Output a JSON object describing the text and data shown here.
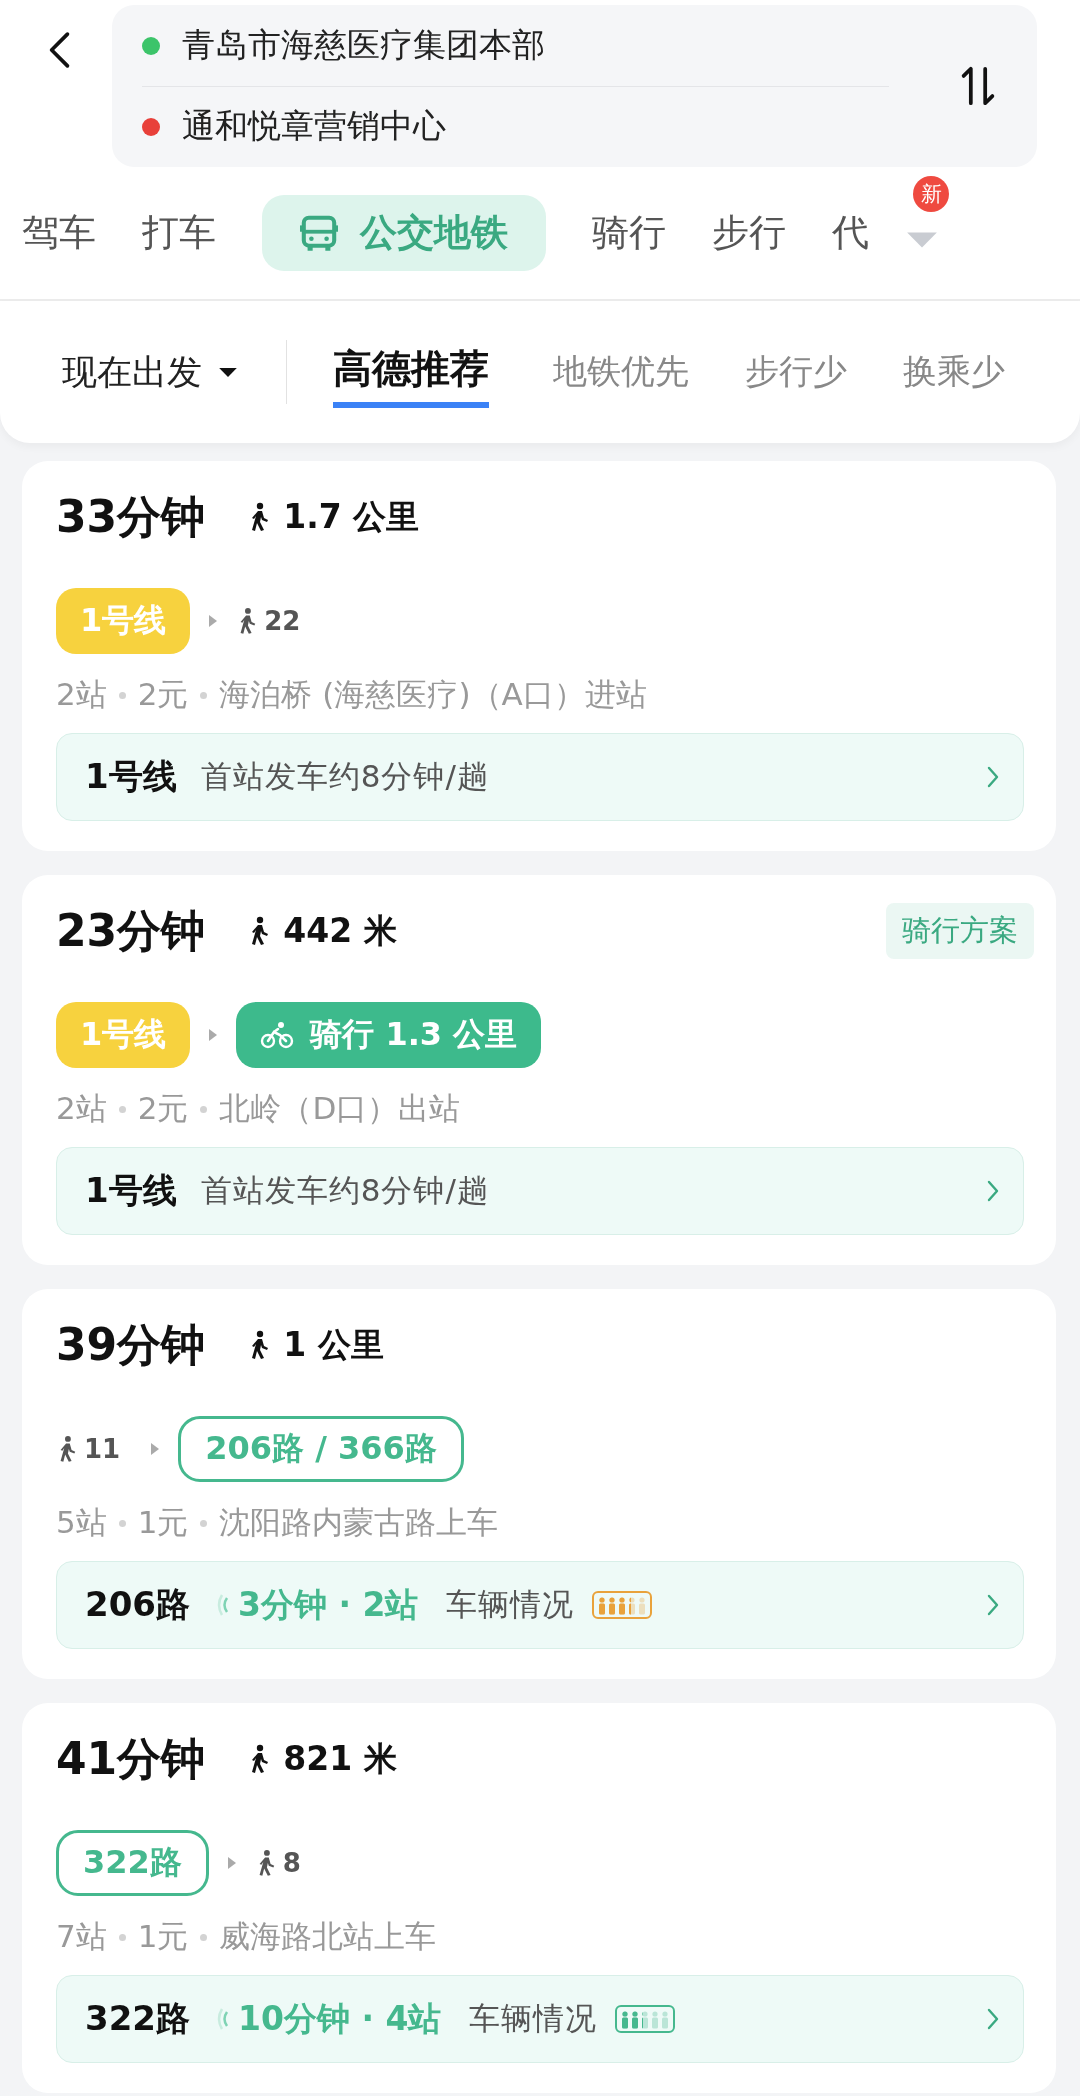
{
  "route": {
    "origin": {
      "name": "青岛市海慈医疗集团本部",
      "color": "#3cc46a"
    },
    "destination": {
      "name": "通和悦章营销中心",
      "color": "#e8403a"
    }
  },
  "modes": [
    {
      "label": "驾车",
      "selected": false
    },
    {
      "label": "打车",
      "selected": false
    },
    {
      "label": "公交地铁",
      "selected": true
    },
    {
      "label": "骑行",
      "selected": false
    },
    {
      "label": "步行",
      "selected": false
    },
    {
      "label": "代",
      "selected": false
    }
  ],
  "more_badge": "新",
  "departure": "现在出发",
  "sorts": [
    {
      "label": "高德推荐",
      "selected": true
    },
    {
      "label": "地铁优先",
      "selected": false
    },
    {
      "label": "步行少",
      "selected": false
    },
    {
      "label": "换乘少",
      "selected": false
    }
  ],
  "plans": [
    {
      "time": "33分钟",
      "walk": "1.7 公里",
      "segments": [
        {
          "kind": "line",
          "label": "1号线"
        },
        {
          "kind": "walk",
          "label": "22"
        }
      ],
      "details": [
        "2站",
        "2元",
        "海泊桥 (海慈医疗)（A口）进站"
      ],
      "bar": {
        "line": "1号线",
        "info": "首站发车约8分钟/趟"
      }
    },
    {
      "time": "23分钟",
      "walk": "442 米",
      "badge": "骑行方案",
      "segments": [
        {
          "kind": "line",
          "label": "1号线"
        },
        {
          "kind": "bike",
          "label": "骑行 1.3 公里"
        }
      ],
      "details": [
        "2站",
        "2元",
        "北岭（D口）出站"
      ],
      "bar": {
        "line": "1号线",
        "info": "首站发车约8分钟/趟"
      }
    },
    {
      "time": "39分钟",
      "walk": "1 公里",
      "segments": [
        {
          "kind": "walk",
          "label": "11"
        },
        {
          "kind": "bus",
          "label": "206路 / 366路"
        }
      ],
      "details": [
        "5站",
        "1元",
        "沈阳路内蒙古路上车"
      ],
      "bar": {
        "line": "206路",
        "realtime": "3分钟 · 2站",
        "status": "车辆情况",
        "crowd": {
          "level": 0.6,
          "color": "#e9a23b"
        }
      }
    },
    {
      "time": "41分钟",
      "walk": "821 米",
      "segments": [
        {
          "kind": "bus",
          "label": "322路"
        },
        {
          "kind": "walk",
          "label": "8"
        }
      ],
      "details": [
        "7站",
        "1元",
        "威海路北站上车"
      ],
      "bar": {
        "line": "322路",
        "realtime": "10分钟 · 4站",
        "status": "车辆情况",
        "crowd": {
          "level": 0.4,
          "color": "#45b88e"
        }
      }
    }
  ]
}
